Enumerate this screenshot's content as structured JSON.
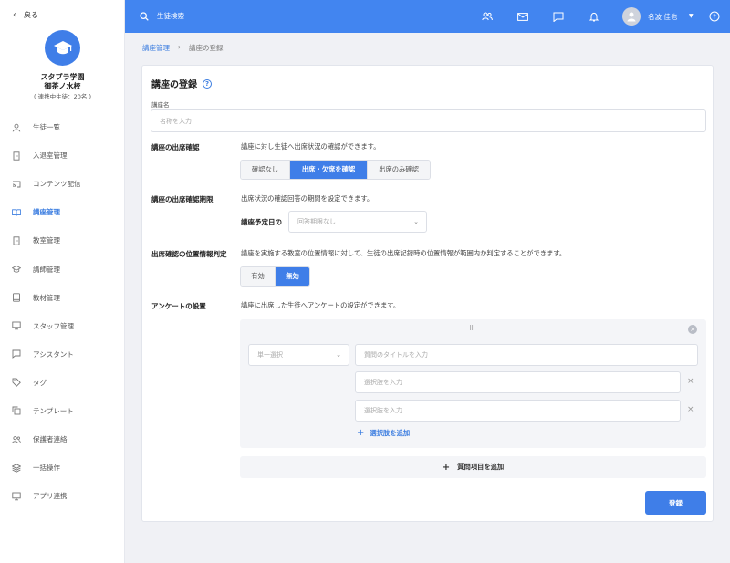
{
  "sidebar": {
    "back_label": "戻る",
    "school_name_1": "スタプラ学園",
    "school_name_2": "御茶ノ水校",
    "school_meta": "( 連携中生徒：20名 )",
    "items": [
      {
        "label": "生徒一覧",
        "icon": "person-icon"
      },
      {
        "label": "入退室管理",
        "icon": "door-icon"
      },
      {
        "label": "コンテンツ配信",
        "icon": "cast-icon"
      },
      {
        "label": "講座管理",
        "icon": "book-open-icon",
        "active": true
      },
      {
        "label": "教室管理",
        "icon": "door-icon"
      },
      {
        "label": "講師管理",
        "icon": "graduation-cap-icon"
      },
      {
        "label": "教材管理",
        "icon": "book-icon"
      },
      {
        "label": "スタッフ管理",
        "icon": "monitor-icon"
      },
      {
        "label": "アシスタント",
        "icon": "chat-icon"
      },
      {
        "label": "タグ",
        "icon": "tag-icon"
      },
      {
        "label": "テンプレート",
        "icon": "copy-icon"
      },
      {
        "label": "保護者連絡",
        "icon": "people-icon"
      },
      {
        "label": "一括操作",
        "icon": "layers-icon"
      },
      {
        "label": "アプリ連携",
        "icon": "monitor-icon"
      }
    ]
  },
  "header": {
    "search_placeholder": "生徒検索",
    "user_name": "名波 佳也",
    "accent": "#4285f0"
  },
  "breadcrumb": {
    "parent": "講座管理",
    "current": "講座の登録"
  },
  "form": {
    "title": "講座の登録",
    "name_label": "講座名",
    "name_placeholder": "名称を入力",
    "attendance": {
      "label": "講座の出席確認",
      "desc": "講座に対し生徒へ出席状況の確認ができます。",
      "options": [
        "確認なし",
        "出席・欠席を確認",
        "出席のみ確認"
      ],
      "selected": "出席・欠席を確認"
    },
    "deadline": {
      "label": "講座の出席確認期限",
      "desc": "出席状況の確認回答の期間を設定できます。",
      "sub_label": "講座予定日の",
      "select_value": "回答期限なし"
    },
    "location": {
      "label": "出席確認の位置情報判定",
      "desc": "講座を実施する教室の位置情報に対して、生徒の出席記録時の位置情報が範囲内か判定することができます。",
      "options": [
        "有効",
        "無効"
      ],
      "selected": "無効"
    },
    "survey": {
      "label": "アンケートの設置",
      "desc": "講座に出席した生徒へアンケートの設定ができます。",
      "type_value": "単一選択",
      "question_placeholder": "質問のタイトルを入力",
      "option_placeholders": [
        "選択肢を入力",
        "選択肢を入力"
      ],
      "add_option_label": "選択肢を追加",
      "add_question_label": "質問項目を追加"
    },
    "submit_label": "登録"
  }
}
